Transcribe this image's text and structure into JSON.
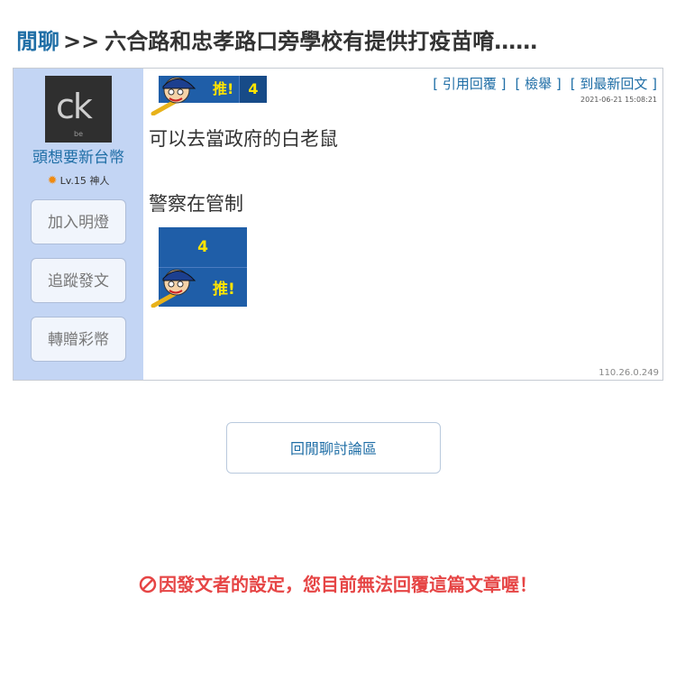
{
  "header": {
    "forum": "閒聊",
    "separator": ">>",
    "thread_title": "六合路和忠孝路口旁學校有提供打疫苗唷……"
  },
  "post": {
    "user": {
      "avatar_text": "ck",
      "avatar_sub": "be",
      "name": "頭想要新台幣",
      "level": "Lv.15 神人"
    },
    "side_buttons": [
      "加入明燈",
      "追蹤發文",
      "轉贈彩幣"
    ],
    "push_badge": {
      "label": "推!",
      "count": "4"
    },
    "links": [
      "[ 引用回覆 ]",
      "[ 檢舉 ]",
      "[ 到最新回文 ]"
    ],
    "timestamp": "2021-06-21 15:08:21",
    "lines": [
      "可以去當政府的白老鼠",
      "警察在管制"
    ],
    "big_badge": {
      "count": "4",
      "label": "推!"
    },
    "ip": "110.26.0.249"
  },
  "back_button": "回閒聊討論區",
  "notice": "因發文者的設定，您目前無法回覆這篇文章喔！",
  "colors": {
    "accent": "#1f6ea6",
    "sidebar": "#c3d5f4",
    "badge": "#1f5ea8",
    "warning": "#e64545"
  },
  "icons": {
    "level": "sun-icon",
    "notice": "ban-icon",
    "badge": "baseball-mascot-icon"
  }
}
